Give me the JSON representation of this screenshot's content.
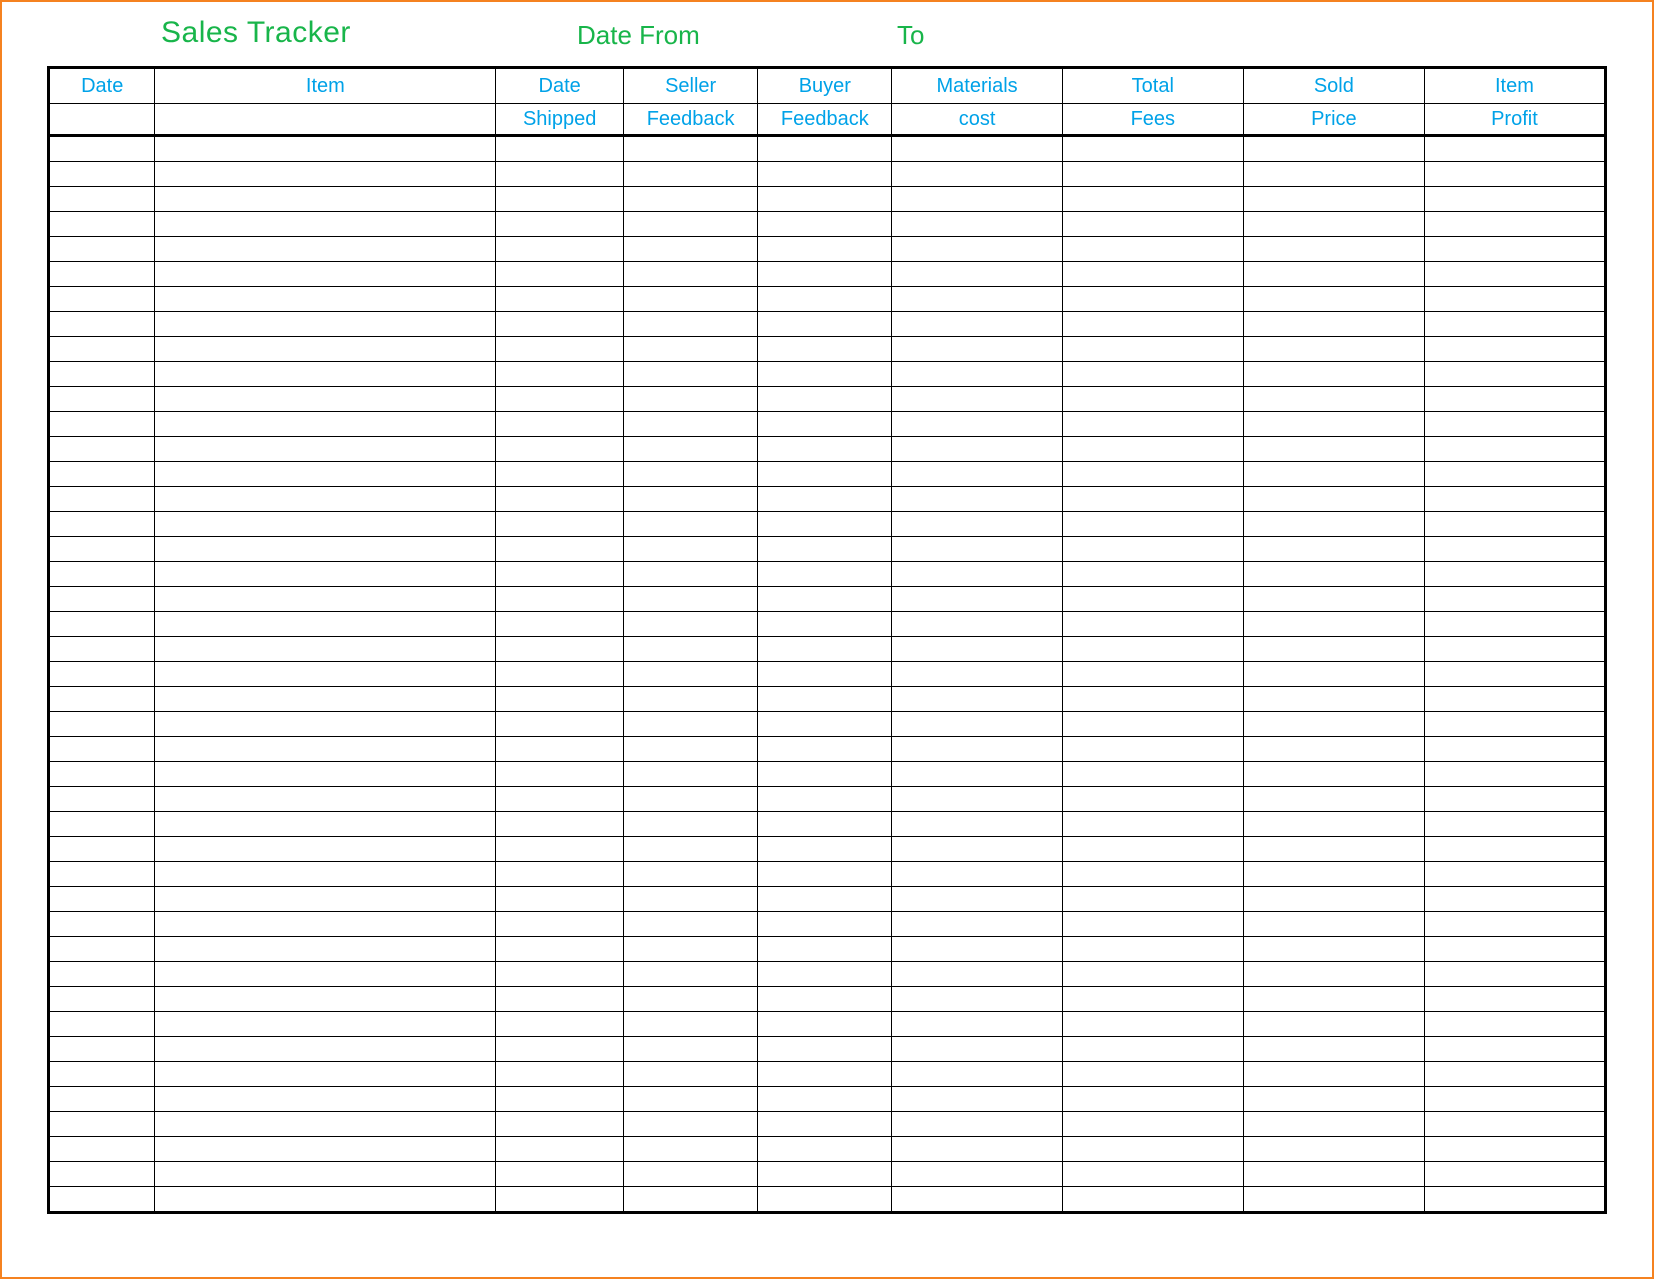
{
  "header": {
    "title": "Sales Tracker",
    "date_from_label": "Date From",
    "to_label": "To"
  },
  "columns": {
    "row1": [
      "Date",
      "Item",
      "Date",
      "Seller",
      "Buyer",
      "Materials",
      "Total",
      "Sold",
      "Item"
    ],
    "row2": [
      "",
      "",
      "Shipped",
      "Feedback",
      "Feedback",
      "cost",
      "Fees",
      "Price",
      "Profit"
    ]
  },
  "row_count": 43
}
